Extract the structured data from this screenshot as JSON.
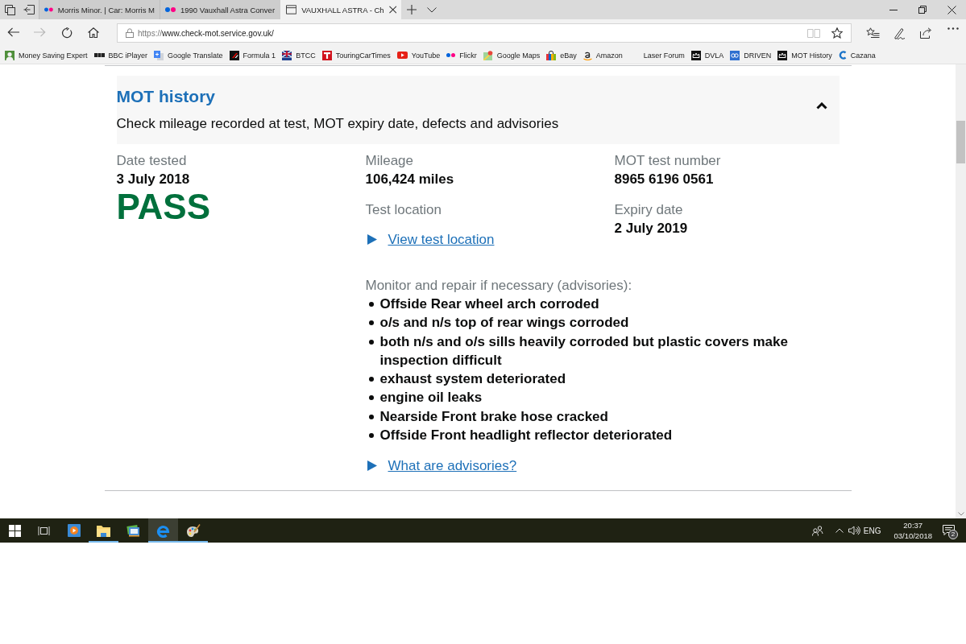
{
  "browser": {
    "tabs": [
      {
        "title": "Morris Minor. | Car: Morris M",
        "kind": "dots",
        "selected": false
      },
      {
        "title": "1990 Vauxhall Astra Conver",
        "kind": "dots",
        "selected": false
      },
      {
        "title": "VAUXHALL ASTRA - Ch",
        "kind": "page",
        "selected": true
      }
    ],
    "nav_buttons": [
      {
        "kind": "back",
        "disabled": false
      },
      {
        "kind": "forward",
        "disabled": true
      },
      {
        "kind": "refresh",
        "disabled": false
      },
      {
        "kind": "home",
        "disabled": false
      }
    ],
    "address": {
      "scheme": "https://",
      "rest": "www.check-mot.service.gov.uk/"
    },
    "address_buttons": [
      {
        "kind": "reading-view",
        "disabled": true
      },
      {
        "kind": "favorite",
        "disabled": false
      }
    ],
    "bookmarks": [
      {
        "label": "Money Saving Expert",
        "kind": "portrait"
      },
      {
        "label": "BBC iPlayer",
        "kind": "blocks"
      },
      {
        "label": "Google Translate",
        "kind": "translate"
      },
      {
        "label": "Formula 1",
        "kind": "stripes"
      },
      {
        "label": "BTCC",
        "kind": "flag"
      },
      {
        "label": "TouringCarTimes",
        "kind": "t-tile"
      },
      {
        "label": "YouTube",
        "kind": "play"
      },
      {
        "label": "Flickr",
        "kind": "dots"
      },
      {
        "label": "Google Maps",
        "kind": "map"
      },
      {
        "label": "eBay",
        "kind": "bag"
      },
      {
        "label": "Amazon",
        "kind": "smile"
      },
      {
        "label": "Laser Forum",
        "kind": "blank"
      },
      {
        "label": "DVLA",
        "kind": "crown"
      },
      {
        "label": "DRIVEN",
        "kind": "circles"
      },
      {
        "label": "MOT History",
        "kind": "crown"
      },
      {
        "label": "Cazana",
        "kind": "crescent"
      }
    ]
  },
  "page": {
    "section": {
      "title": "MOT history",
      "subtitle": "Check mileage recorded at test, MOT expiry date, defects and advisories",
      "expanded": true
    },
    "result": {
      "date_label": "Date tested",
      "date": "3 July 2018",
      "kind": "pass",
      "outcome": "PASS",
      "mileage_label": "Mileage",
      "mileage": "106,424 miles",
      "location_label": "Test location",
      "location_link": "View test location",
      "number_label": "MOT test number",
      "number": "8965 6196 0561",
      "expiry_label": "Expiry date",
      "expiry": "2 July 2019"
    },
    "advisories": {
      "heading": "Monitor and repair if necessary (advisories):",
      "items": [
        "Offside Rear wheel arch corroded",
        "o/s and n/s top of rear wings corroded",
        "both n/s and o/s sills heavily corroded but plastic covers make inspection difficult",
        "exhaust system deteriorated",
        "engine oil leaks",
        "Nearside Front brake hose cracked",
        "Offside Front headlight reflector deteriorated"
      ],
      "link": "What are advisories?"
    }
  },
  "taskbar": {
    "apps": [
      {
        "kind": "media",
        "running": false,
        "selected": false
      },
      {
        "kind": "explorer",
        "running": true,
        "selected": false
      },
      {
        "kind": "photos",
        "running": false,
        "selected": false
      },
      {
        "kind": "edge",
        "running": true,
        "selected": true
      },
      {
        "kind": "paint",
        "running": true,
        "selected": false
      }
    ],
    "tray": {
      "language": "ENG",
      "time": "20:37",
      "date": "03/10/2018",
      "notifications": "2"
    }
  }
}
